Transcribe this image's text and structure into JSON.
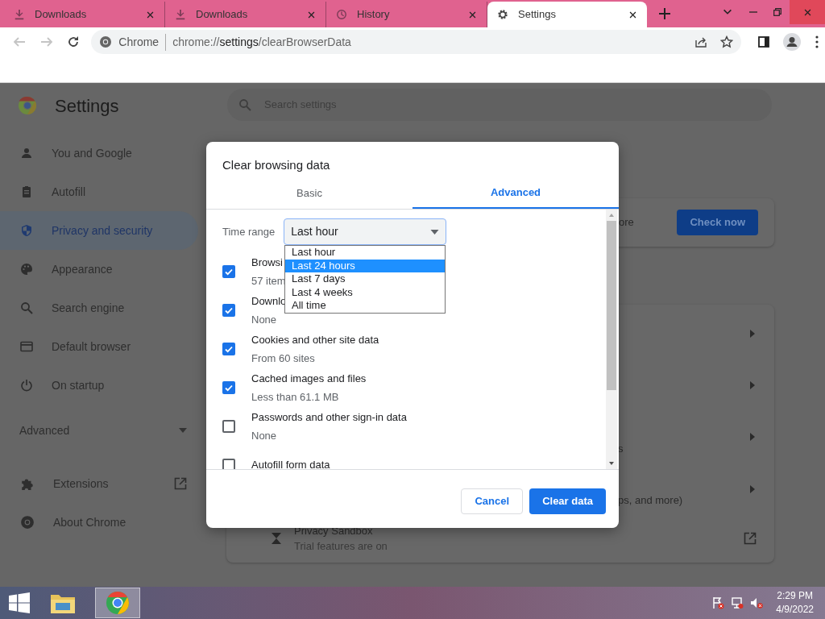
{
  "browser_tabs": [
    {
      "title": "Downloads",
      "kind": "download",
      "selected": false
    },
    {
      "title": "Downloads",
      "kind": "download",
      "selected": false
    },
    {
      "title": "History",
      "kind": "history",
      "selected": false
    },
    {
      "title": "Settings",
      "kind": "gear",
      "selected": true
    }
  ],
  "nav_buttons": [
    {
      "kind": "back",
      "disabled": true
    },
    {
      "kind": "forward",
      "disabled": true
    },
    {
      "kind": "reload",
      "disabled": false
    }
  ],
  "omnibox": {
    "chip": "Chrome",
    "url_scheme": "chrome://",
    "url_host": "settings",
    "url_path": "/clearBrowserData"
  },
  "settings_page": {
    "title": "Settings",
    "search_placeholder": "Search settings",
    "sidebar": [
      {
        "label": "You and Google",
        "kind": "person",
        "selected": false
      },
      {
        "label": "Autofill",
        "kind": "clipboard",
        "selected": false
      },
      {
        "label": "Privacy and security",
        "kind": "shield",
        "selected": true
      },
      {
        "label": "Appearance",
        "kind": "palette",
        "selected": false
      },
      {
        "label": "Search engine",
        "kind": "search",
        "selected": false
      },
      {
        "label": "Default browser",
        "kind": "browser",
        "selected": false
      },
      {
        "label": "On startup",
        "kind": "power",
        "selected": false
      }
    ],
    "advanced": {
      "label": "Advanced",
      "expanded": false
    },
    "extra_items": [
      {
        "label": "Extensions",
        "kind": "puzzle",
        "external": true
      },
      {
        "label": "About Chrome",
        "kind": "chrome",
        "external": false
      }
    ],
    "safety_card": {
      "text_fragment": "ore",
      "button": "Check now"
    },
    "privacy_row_fragments": [
      "s",
      "ps, and more)"
    ],
    "sandbox_row": {
      "title": "Privacy Sandbox",
      "detail": "Trial features are on"
    }
  },
  "dialog": {
    "title": "Clear browsing data",
    "tabs": [
      {
        "label": "Basic",
        "selected": false
      },
      {
        "label": "Advanced",
        "selected": true
      }
    ],
    "time_range": {
      "label": "Time range",
      "value": "Last hour",
      "options": [
        {
          "label": "Last hour",
          "highlighted": false
        },
        {
          "label": "Last 24 hours",
          "highlighted": true
        },
        {
          "label": "Last 7 days",
          "highlighted": false
        },
        {
          "label": "Last 4 weeks",
          "highlighted": false
        },
        {
          "label": "All time",
          "highlighted": false
        }
      ]
    },
    "items": [
      {
        "label": "Browsi",
        "detail": "57 item",
        "checked": true
      },
      {
        "label": "Downlo",
        "detail": "None",
        "checked": true
      },
      {
        "label": "Cookies and other site data",
        "detail": "From 60 sites",
        "checked": true
      },
      {
        "label": "Cached images and files",
        "detail": "Less than 61.1 MB",
        "checked": true
      },
      {
        "label": "Passwords and other sign-in data",
        "detail": "None",
        "checked": false
      },
      {
        "label": "Autofill form data",
        "checked": false
      }
    ],
    "buttons": [
      {
        "label": "Cancel",
        "kind": "secondary"
      },
      {
        "label": "Clear data",
        "kind": "primary"
      }
    ]
  },
  "taskbar": {
    "apps": [
      {
        "kind": "explorer",
        "selected": false
      },
      {
        "kind": "chrome",
        "selected": true
      }
    ],
    "time": "2:29 PM",
    "date": "4/9/2022"
  }
}
